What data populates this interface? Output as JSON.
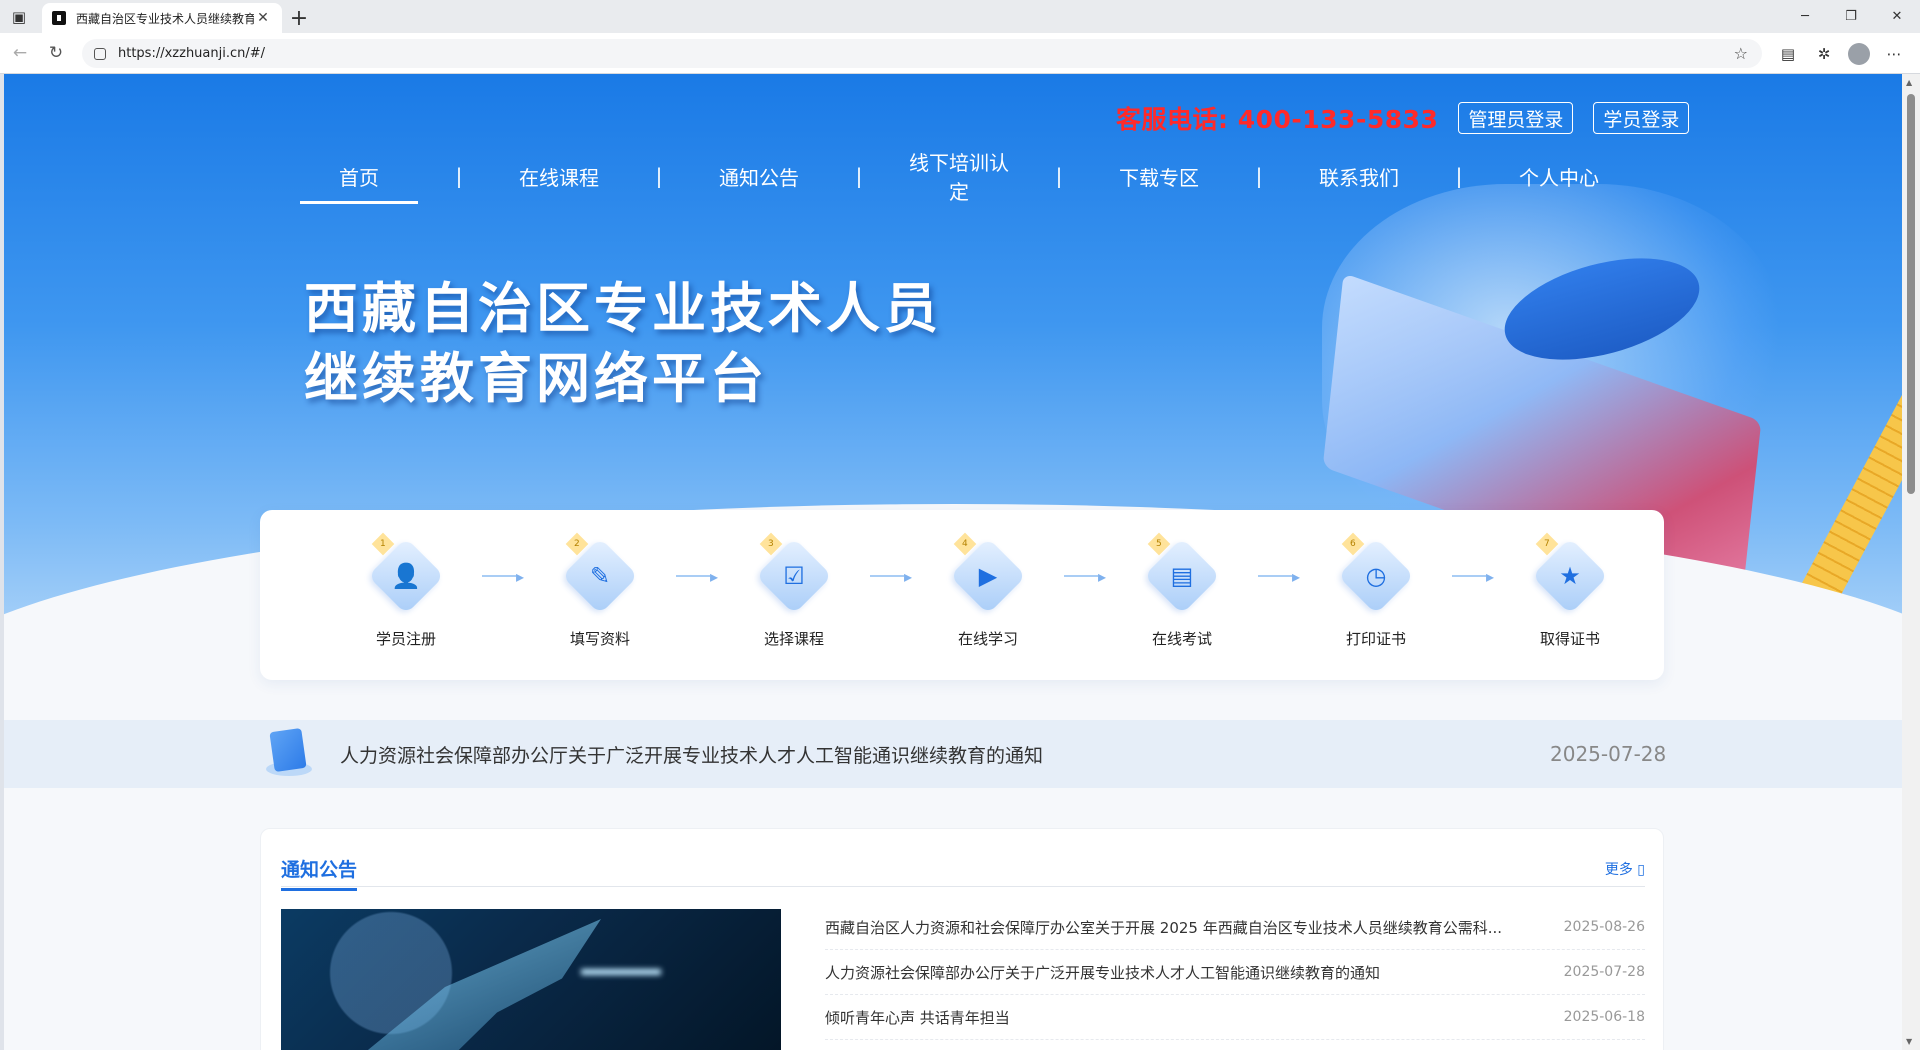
{
  "browser": {
    "tab_title": "西藏自治区专业技术人员继续教育",
    "url": "https://xzzhuanji.cn/#/",
    "window_controls": [
      "minimize-icon",
      "restore-icon",
      "close-icon"
    ]
  },
  "header": {
    "hotline": "客服电话: 400-133-5833",
    "admin_login": "管理员登录",
    "student_login": "学员登录"
  },
  "nav": {
    "items": [
      "首页",
      "在线课程",
      "通知公告",
      "线下培训认定",
      "下载专区",
      "联系我们",
      "个人中心"
    ],
    "separator": "|",
    "active_index": 0
  },
  "hero": {
    "title_line1": "西藏自治区专业技术人员",
    "title_line2": "继续教育网络平台"
  },
  "process": {
    "steps": [
      {
        "num": "1",
        "label": "学员注册",
        "icon": "user-add-icon"
      },
      {
        "num": "2",
        "label": "填写资料",
        "icon": "edit-icon"
      },
      {
        "num": "3",
        "label": "选择课程",
        "icon": "select-course-icon"
      },
      {
        "num": "4",
        "label": "在线学习",
        "icon": "video-play-icon"
      },
      {
        "num": "5",
        "label": "在线考试",
        "icon": "exam-icon"
      },
      {
        "num": "6",
        "label": "打印证书",
        "icon": "print-certificate-icon"
      },
      {
        "num": "7",
        "label": "取得证书",
        "icon": "certificate-icon"
      }
    ]
  },
  "newsbar": {
    "text": "人力资源社会保障部办公厅关于广泛开展专业技术人才人工智能通识继续教育的通知",
    "date": "2025-07-28"
  },
  "notice": {
    "title": "通知公告",
    "more": "更多 ▯",
    "items": [
      {
        "title": "西藏自治区人力资源和社会保障厅办公室关于开展 2025 年西藏自治区专业技术人员继续教育公需科...",
        "date": "2025-08-26"
      },
      {
        "title": "人力资源社会保障部办公厅关于广泛开展专业技术人才人工智能通识继续教育的通知",
        "date": "2025-07-28"
      },
      {
        "title": "倾听青年心声 共话青年担当",
        "date": "2025-06-18"
      }
    ]
  }
}
